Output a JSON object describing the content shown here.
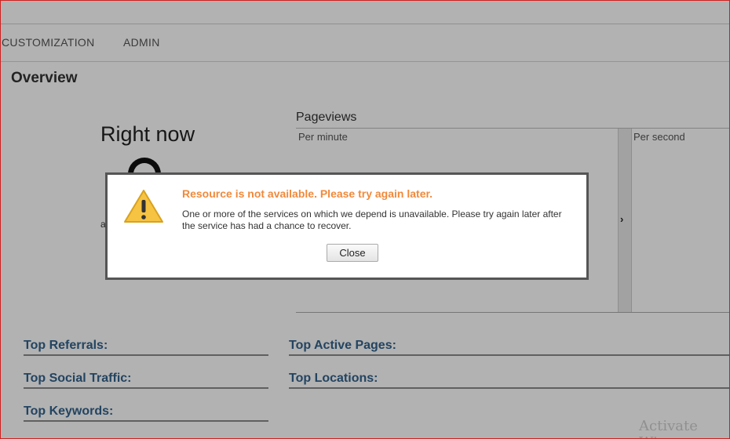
{
  "nav": {
    "items": [
      {
        "label": "CUSTOMIZATION"
      },
      {
        "label": "ADMIN"
      }
    ]
  },
  "page": {
    "title": "Overview"
  },
  "realtime": {
    "right_now_label": "Right now",
    "count": "0",
    "small_label": "a"
  },
  "pageviews": {
    "title": "Pageviews",
    "per_minute_label": "Per minute",
    "per_second_label": "Per second",
    "next_arrow": "›"
  },
  "sections": {
    "top_referrals": "Top Referrals:",
    "top_social": "Top Social Traffic:",
    "top_keywords": "Top Keywords:",
    "top_active_pages": "Top Active Pages:",
    "top_locations": "Top Locations:"
  },
  "watermark": "Activate Win",
  "dialog": {
    "icon": "warning-icon",
    "title": "Resource is not available. Please try again later.",
    "message": "One or more of the services on which we depend is unavailable. Please try again later after the service has had a chance to recover.",
    "close_label": "Close"
  },
  "colors": {
    "accent_title": "#f08a3c",
    "section_link": "#33628c",
    "frame_border": "#d02020"
  }
}
